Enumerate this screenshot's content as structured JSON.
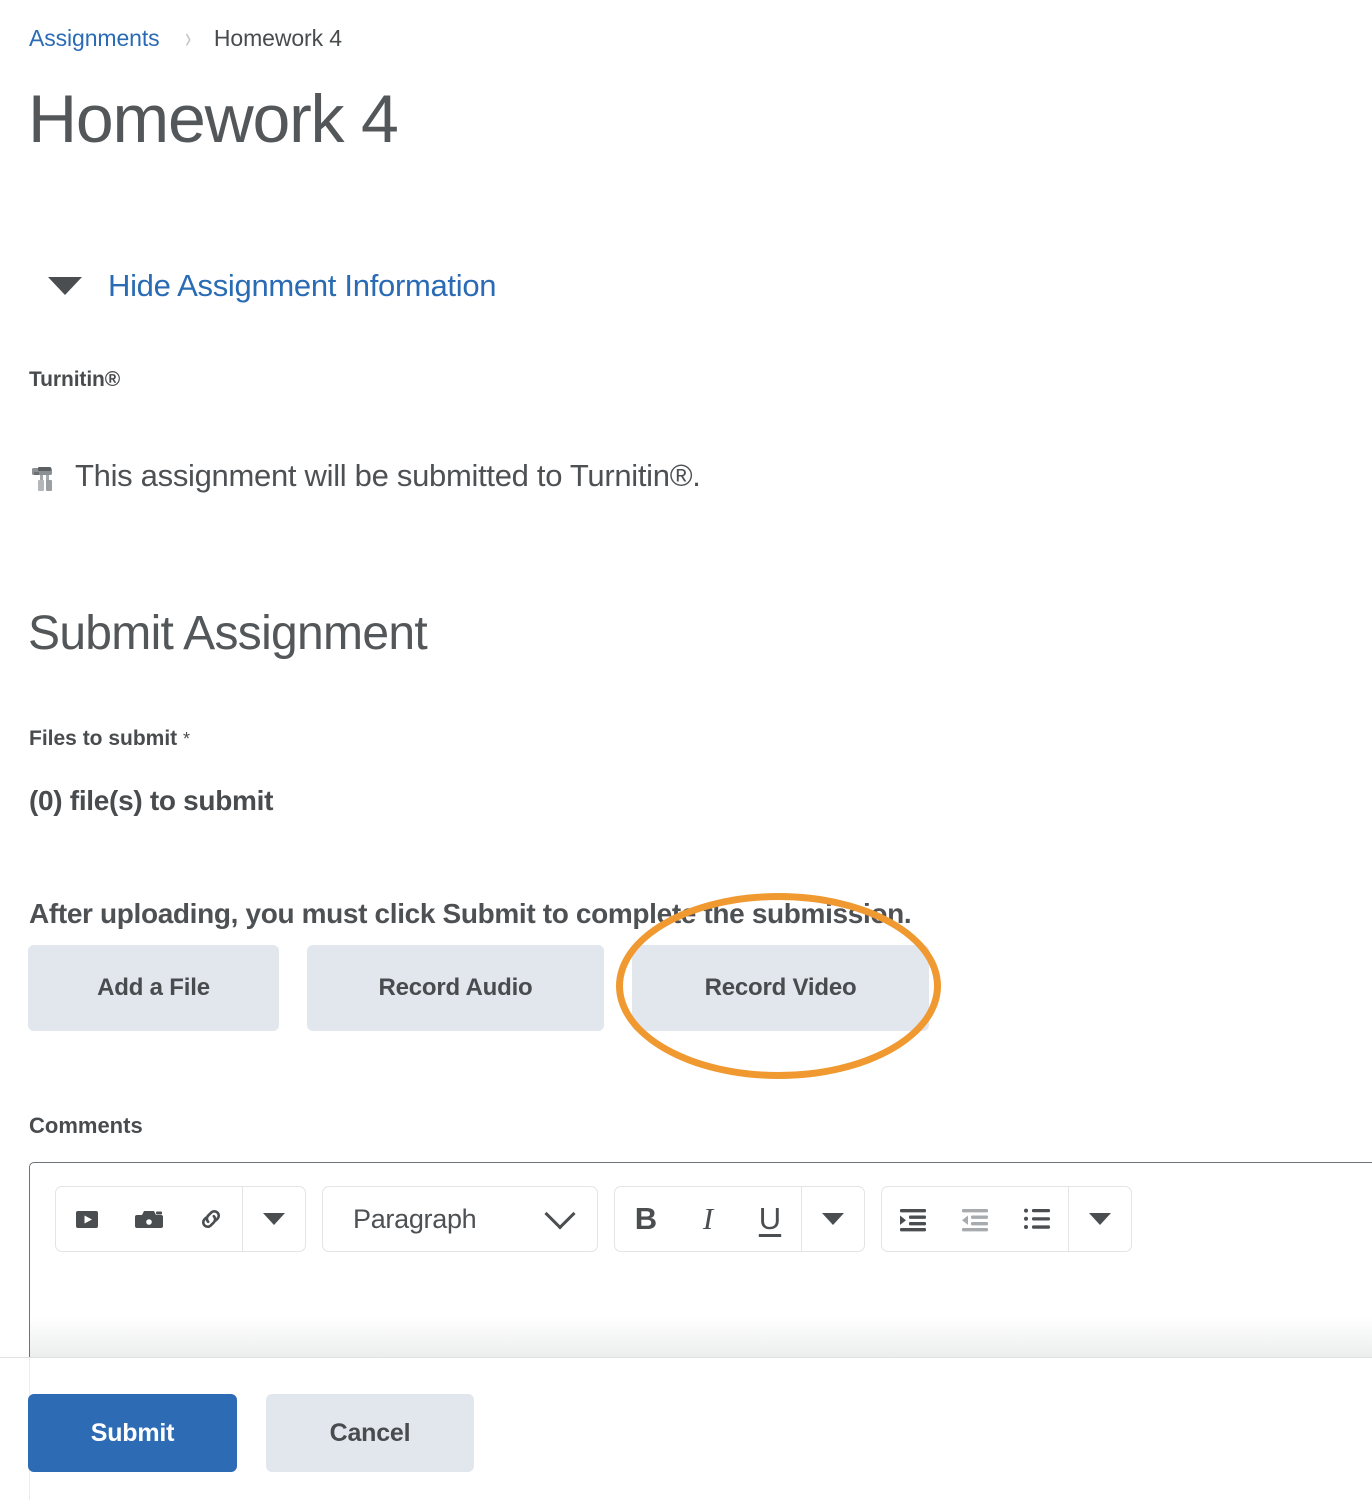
{
  "breadcrumb": {
    "parent_label": "Assignments",
    "separator": "chevron-right-icon",
    "current_label": "Homework 4"
  },
  "page_title": "Homework 4",
  "assignment_info": {
    "toggle_label": "Hide Assignment Information",
    "toggle_state": "expanded",
    "turnitin_heading": "Turnitin®",
    "turnitin_note": "This assignment will be submitted to Turnitin®.",
    "turnitin_icon": "turnitin-robot-icon"
  },
  "submit_section": {
    "heading": "Submit Assignment",
    "files_label": "Files to submit",
    "required_marker": "*",
    "files_count_text": "(0) file(s) to submit",
    "upload_note": "After uploading, you must click Submit to complete the submission.",
    "attach_buttons": [
      {
        "label": "Add a File",
        "name": "add-a-file-button"
      },
      {
        "label": "Record Audio",
        "name": "record-audio-button"
      },
      {
        "label": "Record Video",
        "name": "record-video-button"
      }
    ],
    "highlighted_button": "Record Video"
  },
  "comments": {
    "label": "Comments",
    "value": "",
    "toolbar": {
      "insert_group": [
        {
          "icon": "insert-video-icon",
          "label": "Insert Video"
        },
        {
          "icon": "insert-image-icon",
          "label": "Insert Image"
        },
        {
          "icon": "insert-link-icon",
          "label": "Insert Link"
        }
      ],
      "insert_more": "chevron-down-icon",
      "format_select": {
        "value": "Paragraph",
        "chevron": "chevron-down-icon"
      },
      "style_group": [
        {
          "icon": "bold-icon",
          "label": "B"
        },
        {
          "icon": "italic-icon",
          "label": "I"
        },
        {
          "icon": "underline-icon",
          "label": "U"
        }
      ],
      "style_more": "chevron-down-icon",
      "list_group": [
        {
          "icon": "indent-increase-icon",
          "label": "Increase Indent",
          "disabled": false
        },
        {
          "icon": "indent-decrease-icon",
          "label": "Decrease Indent",
          "disabled": true
        },
        {
          "icon": "bulleted-list-icon",
          "label": "Bulleted List",
          "disabled": false
        }
      ],
      "list_more": "chevron-down-icon"
    }
  },
  "actions": {
    "submit_label": "Submit",
    "cancel_label": "Cancel"
  },
  "colors": {
    "link_blue": "#2a6bb5",
    "primary_button": "#2d6cb4",
    "secondary_button": "#e2e6ed",
    "text": "#494c4e",
    "annotation_orange": "#ef9930"
  }
}
